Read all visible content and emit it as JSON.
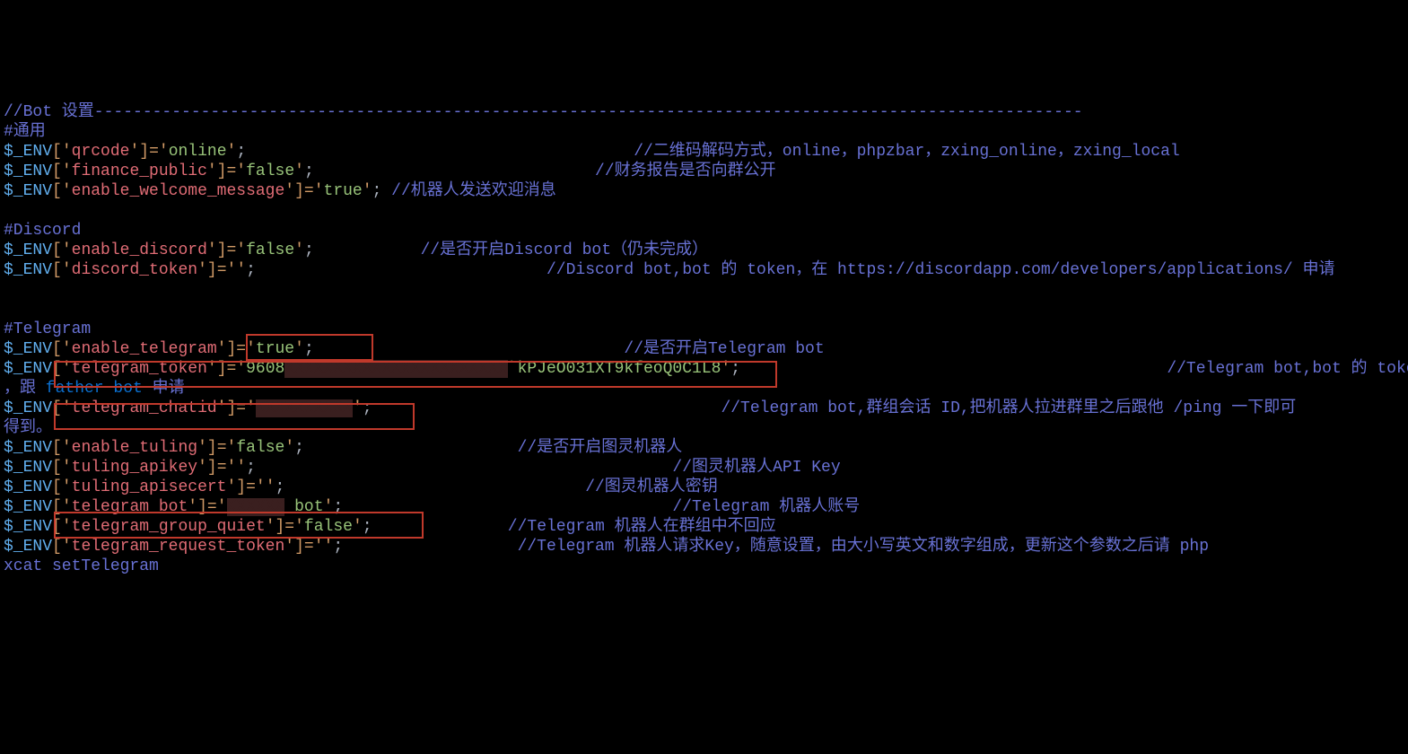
{
  "headers": {
    "bot": "//Bot 设置------------------------------------------------------------------------------------------------------",
    "general": "#通用",
    "discord": "#Discord",
    "telegram": "#Telegram"
  },
  "lines": {
    "qrcode": {
      "env": "$_ENV",
      "ob": "[",
      "q1": "'",
      "key": "qrcode",
      "q2": "'",
      "cb": "]=",
      "q3": "'",
      "val": "online",
      "q4": "'",
      "sc": ";",
      "cmt": "//二维码解码方式，online，phpzbar，zxing_online，zxing_local"
    },
    "finance": {
      "env": "$_ENV",
      "ob": "[",
      "q1": "'",
      "key": "finance_public",
      "q2": "'",
      "cb": "]=",
      "q3": "'",
      "val": "false",
      "q4": "'",
      "sc": ";",
      "cmt": "//财务报告是否向群公开"
    },
    "welcome": {
      "env": "$_ENV",
      "ob": "[",
      "q1": "'",
      "key": "enable_welcome_message",
      "q2": "'",
      "cb": "]=",
      "q3": "'",
      "val": "true",
      "q4": "'",
      "sc": ";",
      "cmt": "//机器人发送欢迎消息"
    },
    "enable_discord": {
      "env": "$_ENV",
      "ob": "[",
      "q1": "'",
      "key": "enable_discord",
      "q2": "'",
      "cb": "]=",
      "q3": "'",
      "val": "false",
      "q4": "'",
      "sc": ";",
      "cmt": "//是否开启Discord bot（仍未完成）"
    },
    "discord_token": {
      "env": "$_ENV",
      "ob": "[",
      "q1": "'",
      "key": "discord_token",
      "q2": "'",
      "cb": "]=",
      "q3": "'",
      "val": "",
      "q4": "'",
      "sc": ";",
      "cmt": "//Discord bot,bot 的 token，在 https://discordapp.com/developers/applications/ 申请"
    },
    "enable_telegram": {
      "env": "$_ENV",
      "ob": "[",
      "q1": "'",
      "key": "enable_telegram",
      "q2": "'",
      "cb": "]=",
      "q3": "'",
      "val": "true",
      "q4": "'",
      "sc": ";",
      "cmt": "//是否开启Telegram bot"
    },
    "telegram_token": {
      "env": "$_ENV",
      "ob": "[",
      "q1": "'",
      "key": "telegram_token",
      "q2": "'",
      "cb": "]=",
      "q3": "'",
      "val_a": "9608",
      "redact": "XXXXXXXXXXXXXXXXXXXXXXX",
      "val_b": "`kPJeO031XT9kfeoQ0C1L8",
      "q4": "'",
      "sc": ";",
      "cmt": "//Telegram bot,bot 的 token"
    },
    "token_cont": {
      "pref": "，跟",
      "fb": " father bot ",
      "suf": "申请"
    },
    "telegram_chatid": {
      "env": "$_ENV",
      "ob": "[",
      "q1": "'",
      "key": "telegram_chatid",
      "q2": "'",
      "cb": "]=",
      "q3": "'",
      "redact": "XXXXXXXXXX",
      "q4": "'",
      "sc": ";",
      "cmt": "//Telegram bot,群组会话 ID,把机器人拉进群里之后跟他 /ping 一下即可"
    },
    "chatid_cont": {
      "txt": "得到。"
    },
    "enable_tuling": {
      "env": "$_ENV",
      "ob": "[",
      "q1": "'",
      "key": "enable_tuling",
      "q2": "'",
      "cb": "]=",
      "q3": "'",
      "val": "false",
      "q4": "'",
      "sc": ";",
      "cmt": "//是否开启图灵机器人"
    },
    "tuling_apikey": {
      "env": "$_ENV",
      "ob": "[",
      "q1": "'",
      "key": "tuling_apikey",
      "q2": "'",
      "cb": "]=",
      "q3": "'",
      "val": "",
      "q4": "'",
      "sc": ";",
      "cmt": "//图灵机器人API Key"
    },
    "tuling_apisecert": {
      "env": "$_ENV",
      "ob": "[",
      "q1": "'",
      "key": "tuling_apisecert",
      "q2": "'",
      "cb": "]=",
      "q3": "'",
      "val": "",
      "q4": "'",
      "sc": ";",
      "cmt": "//图灵机器人密钥"
    },
    "telegram_bot": {
      "env": "$_ENV",
      "ob": "[",
      "q1": "'",
      "key": "telegram_bot",
      "q2": "'",
      "cb": "]=",
      "q3": "'",
      "redact": "XXXXXX",
      "val_b": "_bot",
      "q4": "'",
      "sc": ";",
      "cmt": "//Telegram 机器人账号"
    },
    "telegram_quiet": {
      "env": "$_ENV",
      "ob": "[",
      "q1": "'",
      "key": "telegram_group_quiet",
      "q2": "'",
      "cb": "]=",
      "q3": "'",
      "val": "false",
      "q4": "'",
      "sc": ";",
      "cmt": "//Telegram 机器人在群组中不回应"
    },
    "telegram_req": {
      "env": "$_ENV",
      "ob": "[",
      "q1": "'",
      "key": "telegram_request_token",
      "q2": "'",
      "cb": "]=",
      "q3": "'",
      "val": "",
      "q4": "'",
      "sc": ";",
      "cmt": "//Telegram 机器人请求Key，随意设置，由大小写英文和数字组成，更新这个参数之后请 php"
    },
    "xcat": {
      "txt": "xcat setTelegram"
    }
  },
  "pads": {
    "qrcode": "                                        ",
    "finance": "                             ",
    "welcome": " ",
    "enable_discord": "           ",
    "discord_token": "                              ",
    "enable_telegram": "                                ",
    "telegram_token": "                                            ",
    "telegram_chatid": "                                    ",
    "enable_tuling": "                      ",
    "tuling_apikey": "                                           ",
    "tuling_apisecert": "                               ",
    "telegram_bot": "                                  ",
    "telegram_quiet": "              ",
    "telegram_req": "                  "
  }
}
